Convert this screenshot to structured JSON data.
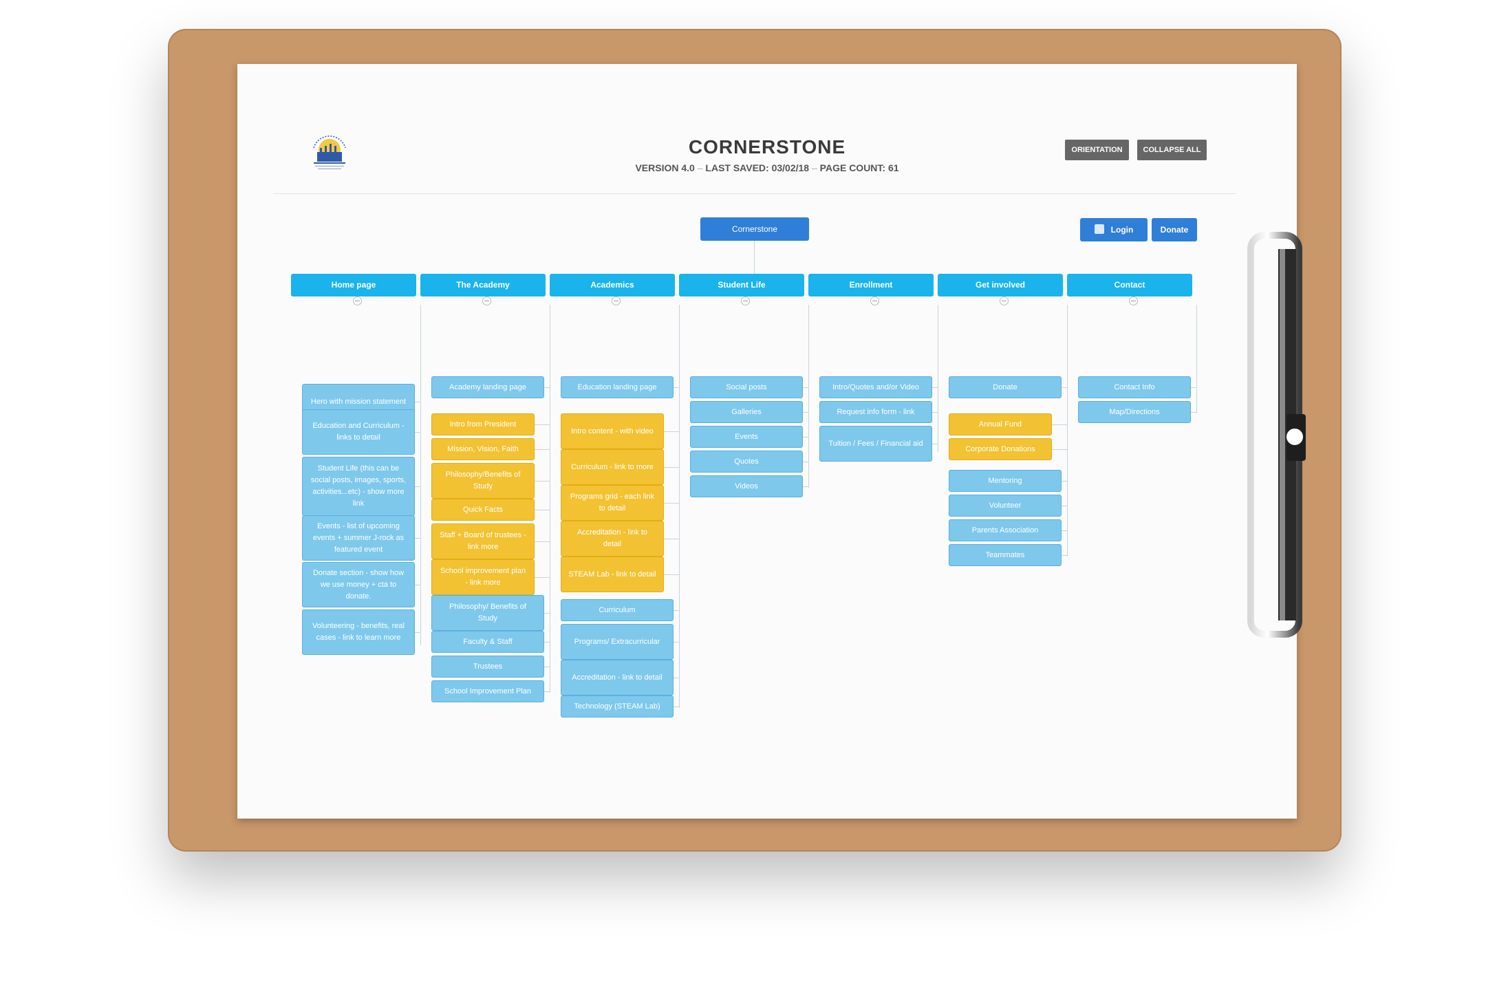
{
  "header": {
    "title": "CORNERSTONE",
    "version": "VERSION 4.0",
    "separator": "–",
    "last_saved": "LAST SAVED: 03/02/18",
    "page_count": "PAGE COUNT: 61",
    "orientation_label": "ORIENTATION",
    "collapse_label": "COLLAPSE ALL"
  },
  "root": {
    "label": "Cornerstone"
  },
  "utility": {
    "login_label": "Login",
    "donate_label": "Donate",
    "login_icon": "page-icon"
  },
  "columns": [
    {
      "label": "Home page",
      "items": [
        "Hero with mission statement",
        "Education and Curriculum - links to detail",
        "Student Life (this can be social posts, images, sports, activities...etc) - show more link",
        "Events - list of upcoming events + summer J-rock as featured event",
        "Donate section - show how we use money + cta to donate.",
        "Volunteering - benefits, real cases - link to learn more"
      ]
    },
    {
      "label": "The Academy",
      "items": [
        "Academy landing page",
        "Intro from President",
        "Mission, Vision, Faith",
        "Philosophy/Benefits of Study",
        "Quick Facts",
        "Staff + Board of trustees - link more",
        "School improvement plan - link more",
        "Philosophy/ Benefits of Study",
        "Faculty & Staff",
        "Trustees",
        "School Improvement Plan"
      ]
    },
    {
      "label": "Academics",
      "items": [
        "Education landing page",
        "Intro content - with video",
        "Curriculum - link to more",
        "Programs grid - each link to detail",
        "Accreditation - link to detail",
        "STEAM Lab - link to detail",
        "Curriculum",
        "Programs/ Extracurricular",
        "Accreditation - link to detail",
        "Technology (STEAM Lab)"
      ]
    },
    {
      "label": "Student Life",
      "items": [
        "Social posts",
        "Galleries",
        "Events",
        "Quotes",
        "Videos"
      ]
    },
    {
      "label": "Enrollment",
      "items": [
        "Intro/Quotes and/or Video",
        "Request info form - link",
        "Tuition / Fees / Financial aid"
      ]
    },
    {
      "label": "Get involved",
      "items": [
        "Donate",
        "Annual Fund",
        "Corporate Donations",
        "Mentoring",
        "Volunteer",
        "Parents Association",
        "Teammates"
      ]
    },
    {
      "label": "Contact",
      "items": [
        "Contact Info",
        "Map/Directions"
      ]
    }
  ],
  "colors": {
    "header_blue": "#1ab3ec",
    "node_blue": "#7ec8ec",
    "node_yellow": "#f2c232",
    "root_blue": "#2f7fd8"
  }
}
